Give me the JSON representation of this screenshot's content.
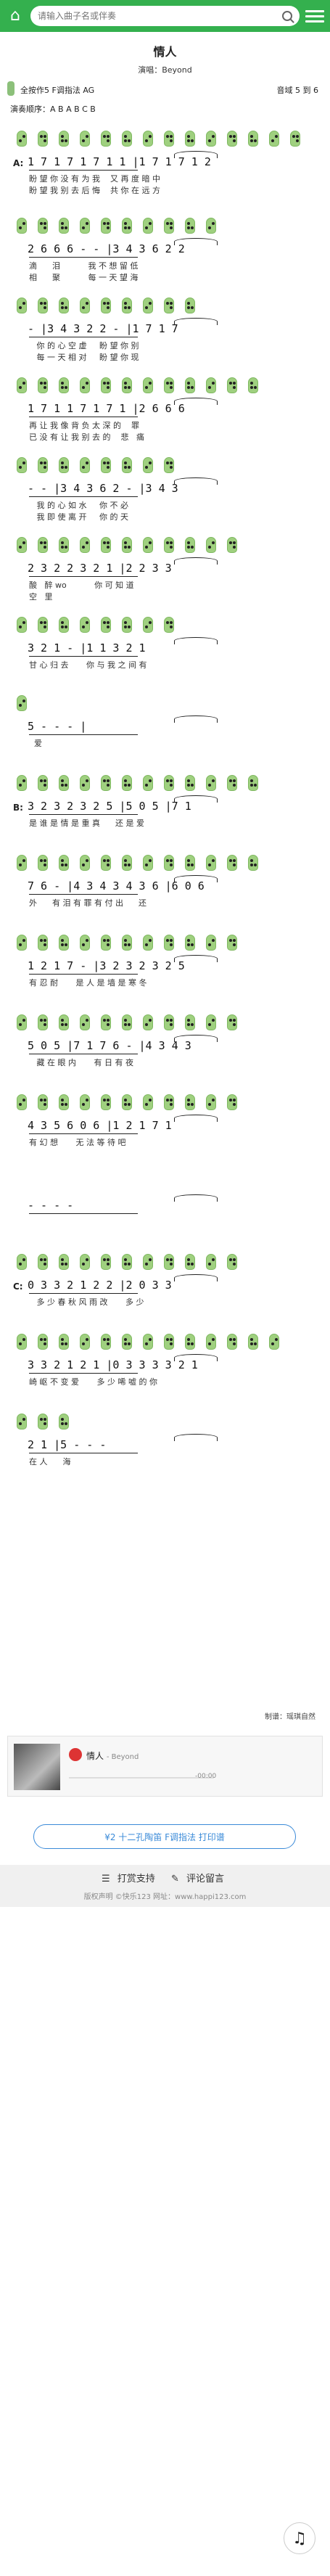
{
  "header": {
    "search_placeholder": "请输入曲子名或伴奏"
  },
  "song": {
    "title": "情人",
    "singer": "演唱：Beyond",
    "key_info": "全按作5  F调指法  AG",
    "range": "音域  5  到  6",
    "order": "演奏顺序：A B A B C B"
  },
  "sections": {
    "A": "A:",
    "B": "B:",
    "C": "C:"
  },
  "rows": [
    {
      "notes": "1 7 1 7 1 7 1 1 |1 7 1 7 1 2",
      "lyric1": "盼 望 你 没 有 为 我    又 再 度 暗 中",
      "lyric2": "盼 望 我 别 去 后 悔    共 你 在 远 方"
    },
    {
      "notes": "2 6 6 6 - - |3 4 3 6 2 2",
      "lyric1": "滴      泪           我 不 想 留 低",
      "lyric2": "相      聚           每 一 天 望 海"
    },
    {
      "notes": "- |3 4 3 2 2 - |1 7 1 7",
      "lyric1": "   你 的 心 空 虚     盼 望 你 别",
      "lyric2": "   每 一 天 相 对     盼 望 你 现"
    },
    {
      "notes": "1 7 1 1 7 1 7 1 |2 6 6 6",
      "lyric1": "再 让 我 像 背 负 太 深 的    罪",
      "lyric2": "已 没 有 让 我 别 去 的    悲   痛"
    },
    {
      "notes": "- - |3 4 3 6 2 - |3 4 3",
      "lyric1": "   我 的 心 如 水     你 不 必",
      "lyric2": "   我 即 使 离 开     你 的 天"
    },
    {
      "notes": "2 3 2 2 3 2 1 |2 2 3 3",
      "lyric1": "酸   醉 wo           你 可 知 道",
      "lyric2": "空   里"
    },
    {
      "notes": "3 2 1 - |1 1 3 2 1",
      "lyric1": "甘 心 归 去       你 与 我 之 间 有",
      "lyric2": ""
    },
    {
      "notes": "5 - - - |",
      "lyric1": "  爱",
      "lyric2": ""
    },
    {
      "notes": "3 2 3 2 3 2 5 |5 0 5 |7 1",
      "lyric1": "是 谁 是 情 是 重 真      还 是 爱",
      "lyric2": ""
    },
    {
      "notes": "7 6 - |4 3 4 3 4 3 6 |6 0 6",
      "lyric1": "外      有 泪 有 罪 有 付 出      还",
      "lyric2": ""
    },
    {
      "notes": "1 2 1 7 - |3 2 3 2 3 2 5",
      "lyric1": "有 忍 耐       是 人 是 墙 是 寒 冬",
      "lyric2": ""
    },
    {
      "notes": "5 0 5 |7 1 7 6 - |4 3 4 3",
      "lyric1": "   藏 在 眼 内       有 日 有 夜",
      "lyric2": ""
    },
    {
      "notes": "4 3 5 6 0 6 |1 2 1 7 1",
      "lyric1": "有 幻 想       无 法 等 待 吧",
      "lyric2": ""
    },
    {
      "notes": "- - - -",
      "lyric1": "",
      "lyric2": ""
    },
    {
      "notes": "0 3 3 2 1 2 2 |2 0 3 3",
      "lyric1": "   多 少 春 秋 风 雨 改       多 少",
      "lyric2": ""
    },
    {
      "notes": "3 3 2 1 2 1 |0 3 3 3 3 2 1",
      "lyric1": "崎 岖 不 变 爱       多 少 唏 嘘 的 你",
      "lyric2": ""
    },
    {
      "notes": "2 1 |5 - - -",
      "lyric1": "在 人      海",
      "lyric2": ""
    }
  ],
  "maker": "制谱：瑶琪自然",
  "player": {
    "song": "情人",
    "artist": "- Beyond",
    "time": "-00:00"
  },
  "print_button": "¥2 十二孔陶笛 F调指法 打印谱",
  "footer": {
    "reward": "打赏支持",
    "comment": "评论留言",
    "copyright": "版权声明  ©快乐123  网址：www.happi123.com"
  }
}
